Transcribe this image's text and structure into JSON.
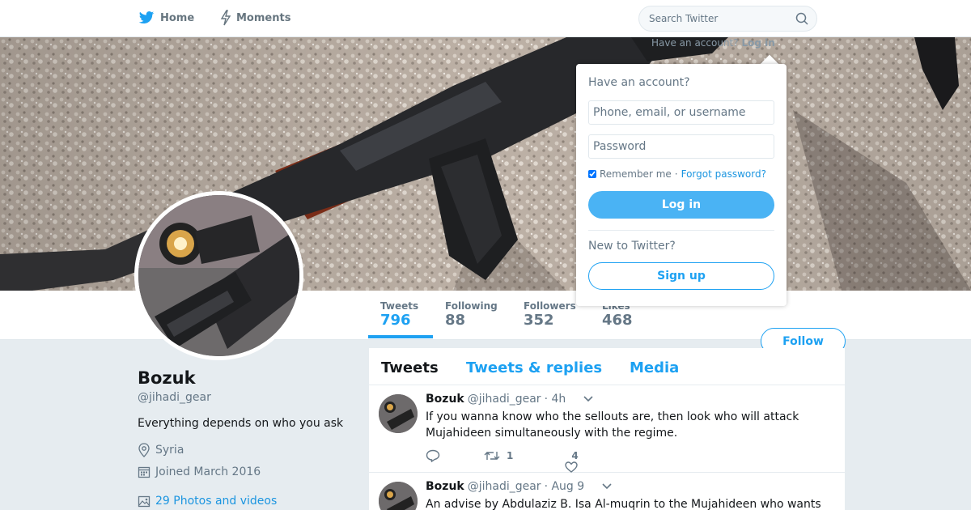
{
  "nav": {
    "home_label": "Home",
    "moments_label": "Moments",
    "search_placeholder": "Search Twitter",
    "have_account_text": "Have an account?",
    "login_link": "Log in"
  },
  "profile": {
    "name": "Bozuk",
    "handle": "@jihadi_gear",
    "bio": "Everything depends on who you ask",
    "location": "Syria",
    "joined": "Joined March 2016",
    "photos_link": "29 Photos and videos",
    "follow_label": "Follow"
  },
  "stats": [
    {
      "label": "Tweets",
      "value": "796"
    },
    {
      "label": "Following",
      "value": "88"
    },
    {
      "label": "Followers",
      "value": "352"
    },
    {
      "label": "Likes",
      "value": "468"
    }
  ],
  "tabs": [
    "Tweets",
    "Tweets & replies",
    "Media"
  ],
  "tweets": [
    {
      "name": "Bozuk",
      "handle": "@jihadi_gear",
      "time": "· 4h",
      "text": "If you wanna know who the sellouts are, then look who will attack Mujahideen simultaneously with the regime.",
      "retweets": "1",
      "likes": "4"
    },
    {
      "name": "Bozuk",
      "handle": "@jihadi_gear",
      "time": "· Aug 9",
      "text": "An advise by Abdulaziz B. Isa Al-muqrin to the Mujahideen who wants"
    }
  ],
  "login": {
    "title": "Have an account?",
    "username_placeholder": "Phone, email, or username",
    "password_placeholder": "Password",
    "remember_label": "Remember me",
    "separator": "·",
    "forgot_label": "Forgot password?",
    "login_button": "Log in",
    "new_text": "New to Twitter?",
    "signup_button": "Sign up"
  },
  "colors": {
    "accent": "#1da1f2",
    "login_button": "#4ab3f4",
    "page_background": "#e6ecf0"
  }
}
